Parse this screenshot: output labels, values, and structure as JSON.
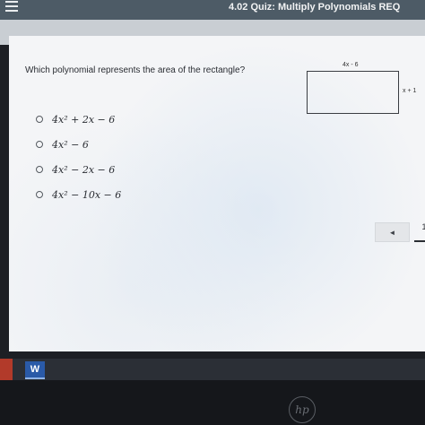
{
  "header": {
    "title": "4.02 Quiz: Multiply Polynomials REQ"
  },
  "question": {
    "text": "Which polynomial represents the area of the rectangle?"
  },
  "figure": {
    "width_label": "4x - 6",
    "height_label": "x + 1"
  },
  "options": [
    {
      "label": "4x² + 2x − 6"
    },
    {
      "label": "4x² − 6"
    },
    {
      "label": "4x² − 2x − 6"
    },
    {
      "label": "4x² − 10x − 6"
    }
  ],
  "navigation": {
    "prev_symbol": "◄",
    "page": "1"
  },
  "taskbar": {
    "word_label": "W"
  },
  "device": {
    "logo_text": "hp"
  },
  "colors": {
    "header_bg": "#4d5b66",
    "panel_bg": "#f4f5f7",
    "taskbar_bg": "#2b2f36"
  }
}
